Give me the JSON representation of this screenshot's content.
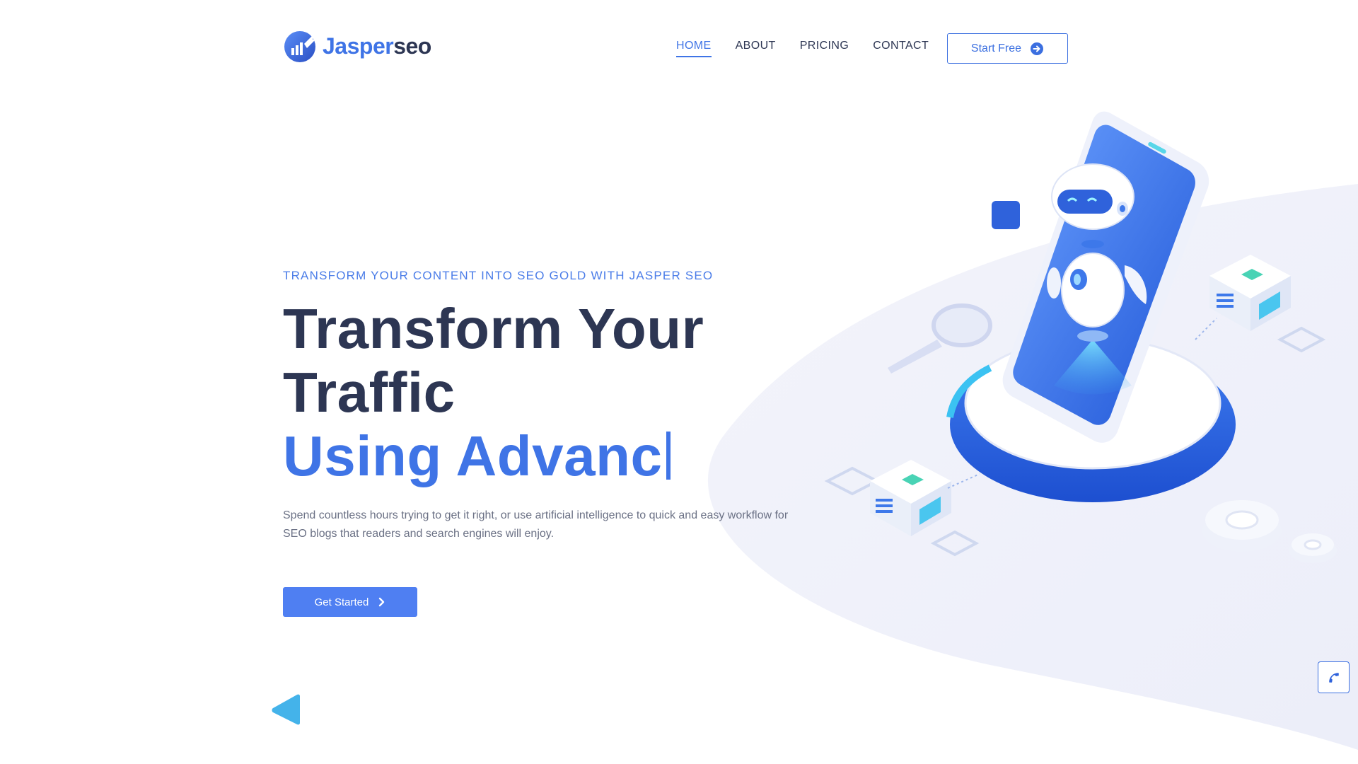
{
  "brand": {
    "name_part1": "Jasper",
    "name_part2": "seo",
    "accent_color": "#3f74e6",
    "dark_color": "#2d3653"
  },
  "nav": {
    "items": [
      {
        "label": "HOME",
        "active": true
      },
      {
        "label": "ABOUT",
        "active": false
      },
      {
        "label": "PRICING",
        "active": false
      },
      {
        "label": "CONTACT",
        "active": false
      }
    ]
  },
  "header": {
    "start_free_label": "Start Free",
    "start_free_icon": "arrow-right-circle-icon"
  },
  "hero": {
    "eyebrow": "TRANSFORM YOUR CONTENT INTO SEO GOLD WITH JASPER SEO",
    "headline_line1": "Transform Your",
    "headline_line2": "Traffic",
    "headline_typed": "Using Advanc",
    "description": "Spend countless hours trying to get it right, or use artificial intelligence to quick and easy workflow for SEO blogs that readers and search engines will enjoy.",
    "cta_label": "Get Started",
    "cta_icon": "chevron-right-icon"
  },
  "illustration": {
    "name": "robot-phone-illustration"
  },
  "floating": {
    "phone_icon": "phone-icon"
  }
}
